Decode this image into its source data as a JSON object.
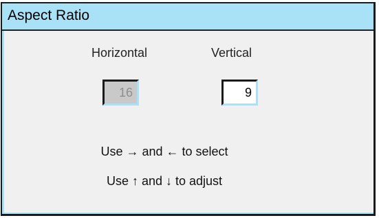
{
  "dialog": {
    "title": "Aspect Ratio"
  },
  "fields": {
    "horizontal_label": "Horizontal",
    "horizontal_value": "16",
    "vertical_label": "Vertical",
    "vertical_value": "9"
  },
  "hints": {
    "select": "Use → and ← to select",
    "adjust": "Use ↑ and ↓ to adjust"
  },
  "colors": {
    "title_bar": "#a9e2f7",
    "background": "#f0f0f0",
    "disabled_field": "#c9c9c9",
    "active_field": "#ffffff"
  }
}
